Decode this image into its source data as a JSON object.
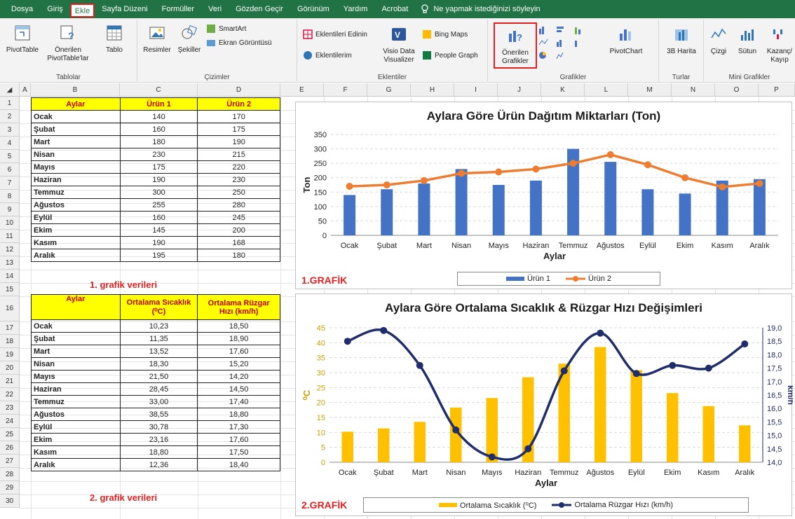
{
  "menu": {
    "tabs": [
      "Dosya",
      "Giriş",
      "Ekle",
      "Sayfa Düzeni",
      "Formüller",
      "Veri",
      "Gözden Geçir",
      "Görünüm",
      "Yardım",
      "Acrobat"
    ],
    "active_tab": "Ekle",
    "tell_me": "Ne yapmak istediğinizi söyleyin"
  },
  "ribbon": {
    "pivottable": "PivotTable",
    "recommended_pivot": "Önerilen PivotTable'lar",
    "table": "Tablo",
    "group_tables": "Tablolar",
    "pictures": "Resimler",
    "shapes": "Şekiller",
    "smartart": "SmartArt",
    "screenshot": "Ekran Görüntüsü",
    "group_illustrations": "Çizimler",
    "get_addins": "Eklentileri Edinin",
    "my_addins": "Eklentilerim",
    "visio": "Visio Data Visualizer",
    "bing_maps": "Bing Maps",
    "people_graph": "People Graph",
    "group_addins": "Eklentiler",
    "recommended_charts": "Önerilen Grafikler",
    "pivotchart": "PivotChart",
    "group_charts": "Grafikler",
    "map3d": "3B Harita",
    "group_tours": "Turlar",
    "line": "Çizgi",
    "column": "Sütun",
    "winloss": "Kazanç/ Kayıp",
    "group_sparklines": "Mini Grafikler"
  },
  "grid": {
    "columns": [
      "A",
      "B",
      "C",
      "D",
      "E",
      "F",
      "G",
      "H",
      "I",
      "J",
      "K",
      "L",
      "M",
      "N",
      "O",
      "P"
    ],
    "rows": [
      "1",
      "2",
      "3",
      "4",
      "5",
      "6",
      "7",
      "8",
      "9",
      "10",
      "11",
      "12",
      "13",
      "14",
      "15",
      "16",
      "17",
      "18",
      "19",
      "20",
      "21",
      "22",
      "23",
      "24",
      "25",
      "26",
      "27",
      "28",
      "29",
      "30"
    ]
  },
  "table1": {
    "headers": [
      "Aylar",
      "Ürün 1",
      "Ürün 2"
    ],
    "rows": [
      [
        "Ocak",
        "140",
        "170"
      ],
      [
        "Şubat",
        "160",
        "175"
      ],
      [
        "Mart",
        "180",
        "190"
      ],
      [
        "Nisan",
        "230",
        "215"
      ],
      [
        "Mayıs",
        "175",
        "220"
      ],
      [
        "Haziran",
        "190",
        "230"
      ],
      [
        "Temmuz",
        "300",
        "250"
      ],
      [
        "Ağustos",
        "255",
        "280"
      ],
      [
        "Eylül",
        "160",
        "245"
      ],
      [
        "Ekim",
        "145",
        "200"
      ],
      [
        "Kasım",
        "190",
        "168"
      ],
      [
        "Aralık",
        "195",
        "180"
      ]
    ],
    "caption": "1. grafik verileri"
  },
  "table2": {
    "headers": [
      "Aylar",
      "Ortalama Sıcaklık",
      "(⁰C)",
      "Ortalama Rüzgar",
      "Hızı (km/h)"
    ],
    "rows": [
      [
        "Ocak",
        "10,23",
        "18,50"
      ],
      [
        "Şubat",
        "11,35",
        "18,90"
      ],
      [
        "Mart",
        "13,52",
        "17,60"
      ],
      [
        "Nisan",
        "18,30",
        "15,20"
      ],
      [
        "Mayıs",
        "21,50",
        "14,20"
      ],
      [
        "Haziran",
        "28,45",
        "14,50"
      ],
      [
        "Temmuz",
        "33,00",
        "17,40"
      ],
      [
        "Ağustos",
        "38,55",
        "18,80"
      ],
      [
        "Eylül",
        "30,78",
        "17,30"
      ],
      [
        "Ekim",
        "23,16",
        "17,60"
      ],
      [
        "Kasım",
        "18,80",
        "17,50"
      ],
      [
        "Aralık",
        "12,36",
        "18,40"
      ]
    ],
    "caption": "2. grafik verileri"
  },
  "chart_data": [
    {
      "type": "bar",
      "title": "Aylara Göre Ürün Dağıtım Miktarları (Ton)",
      "xlabel": "Aylar",
      "ylabel": "Ton",
      "label": "1.GRAFİK",
      "categories": [
        "Ocak",
        "Şubat",
        "Mart",
        "Nisan",
        "Mayıs",
        "Haziran",
        "Temmuz",
        "Ağustos",
        "Eylül",
        "Ekim",
        "Kasım",
        "Aralık"
      ],
      "ylim": [
        0,
        350
      ],
      "yticks": [
        "0",
        "50",
        "100",
        "150",
        "200",
        "250",
        "300",
        "350"
      ],
      "series": [
        {
          "name": "Ürün 1",
          "kind": "bar",
          "color": "#4472c4",
          "values": [
            140,
            160,
            180,
            230,
            175,
            190,
            300,
            255,
            160,
            145,
            190,
            195
          ]
        },
        {
          "name": "Ürün 2",
          "kind": "line",
          "color": "#ed7d31",
          "values": [
            170,
            175,
            190,
            215,
            220,
            230,
            250,
            280,
            245,
            200,
            168,
            180
          ]
        }
      ],
      "legend": "bottom"
    },
    {
      "type": "bar",
      "title": "Aylara Göre Ortalama Sıcaklık & Rüzgar Hızı Değişimleri",
      "xlabel": "Aylar",
      "ylabel": "⁰C",
      "ylabel2": "km/h",
      "label": "2.GRAFİK",
      "categories": [
        "Ocak",
        "Şubat",
        "Mart",
        "Nisan",
        "Mayıs",
        "Haziran",
        "Temmuz",
        "Ağustos",
        "Eylül",
        "Ekim",
        "Kasım",
        "Aralık"
      ],
      "ylim": [
        0,
        45
      ],
      "yticks": [
        "0",
        "5",
        "10",
        "15",
        "20",
        "25",
        "30",
        "35",
        "40",
        "45"
      ],
      "y2lim": [
        14,
        19
      ],
      "y2ticks": [
        "14,0",
        "14,5",
        "15,0",
        "15,5",
        "16,0",
        "16,5",
        "17,0",
        "17,5",
        "18,0",
        "18,5",
        "19,0"
      ],
      "series": [
        {
          "name": "Ortalama Sıcaklık (⁰C)",
          "kind": "bar",
          "color": "#ffc000",
          "values": [
            10.23,
            11.35,
            13.52,
            18.3,
            21.5,
            28.45,
            33.0,
            38.55,
            30.78,
            23.16,
            18.8,
            12.36
          ]
        },
        {
          "name": "Ortalama Rüzgar Hızı (km/h)",
          "kind": "line",
          "axis": "secondary",
          "color": "#1f2d6b",
          "values": [
            18.5,
            18.9,
            17.6,
            15.2,
            14.2,
            14.5,
            17.4,
            18.8,
            17.3,
            17.6,
            17.5,
            18.4
          ]
        }
      ],
      "legend": "bottom"
    }
  ]
}
